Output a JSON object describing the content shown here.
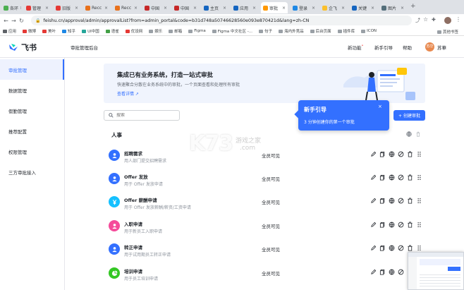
{
  "browser": {
    "tabs": [
      {
        "label": "各环",
        "color": "#4caf50",
        "active": false
      },
      {
        "label": "管理",
        "color": "#e53935",
        "active": false
      },
      {
        "label": "旧版",
        "color": "#e53935",
        "active": false
      },
      {
        "label": "Recc",
        "color": "#e8711c",
        "active": false
      },
      {
        "label": "Recc",
        "color": "#e8711c",
        "active": false
      },
      {
        "label": "中国",
        "color": "#c62828",
        "active": false
      },
      {
        "label": "中国",
        "color": "#c62828",
        "active": false
      },
      {
        "label": "主页",
        "color": "#1565c0",
        "active": false
      },
      {
        "label": "应用",
        "color": "#1565c0",
        "active": false
      },
      {
        "label": "审批",
        "color": "#ff9800",
        "active": true
      },
      {
        "label": "登录",
        "color": "#1e88e5",
        "active": false
      },
      {
        "label": "企飞",
        "color": "#fbc02d",
        "active": false
      },
      {
        "label": "关键",
        "color": "#1565c0",
        "active": false
      },
      {
        "label": "图片",
        "color": "#546e7a",
        "active": false
      }
    ],
    "url": "feishu.cn/approval/admin/approvalList?from=admin_portal&code=b31d748a50746628560e093e870421d&lang=zh-CN",
    "bookmarks": [
      {
        "label": "应用",
        "color": "#5f6368"
      },
      {
        "label": "微博",
        "color": "#e53935"
      },
      {
        "label": "美叶",
        "color": "#e53935"
      },
      {
        "label": "知乎",
        "color": "#1e88e5"
      },
      {
        "label": "UI中国",
        "color": "#26a69a"
      },
      {
        "label": "语雀",
        "color": "#43a047"
      },
      {
        "label": "优设网",
        "color": "#e53935"
      },
      {
        "label": "娱乐",
        "color": "#9aa0a6"
      },
      {
        "label": "邮箱",
        "color": "#9aa0a6"
      },
      {
        "label": "Figma",
        "color": "#9aa0a6"
      },
      {
        "label": "Figma 中文社区 -...",
        "color": "#9aa0a6"
      },
      {
        "label": "句子",
        "color": "#9aa0a6"
      },
      {
        "label": "海内外竞品",
        "color": "#9aa0a6"
      },
      {
        "label": "后台页面",
        "color": "#9aa0a6"
      },
      {
        "label": "插件库",
        "color": "#9aa0a6"
      },
      {
        "label": "ICON",
        "color": "#9aa0a6"
      }
    ],
    "other_bookmarks": "其他书签"
  },
  "header": {
    "logo_text": "飞书",
    "console_title": "审批管理后台",
    "new_features": "新功能",
    "guide": "新手引导",
    "help": "帮助",
    "avatar_text": "苏华",
    "user_name": "苏華"
  },
  "sidebar": {
    "items": [
      {
        "label": "审批管理",
        "active": true
      },
      {
        "label": "数据管理",
        "active": false
      },
      {
        "label": "假勤管理",
        "active": false
      },
      {
        "label": "推荐配置",
        "active": false
      },
      {
        "label": "权限管理",
        "active": false
      },
      {
        "label": "三方审批接入",
        "active": false
      }
    ]
  },
  "banner": {
    "title": "集成已有业务系统，打造一站式审批",
    "desc": "快速聚合分散在业务系统中的审批，一个页面查看和处理所有审批",
    "link": "查看详情 ↗"
  },
  "search": {
    "placeholder": "搜索"
  },
  "create_button": "+ 创建审批",
  "popover": {
    "title": "新手引导",
    "desc": "3 分钟创建你的第一个审批",
    "close": "×"
  },
  "section": {
    "title": "人事"
  },
  "watermark": {
    "big": "K73",
    "small_top": "游戏之家",
    "small_bottom": ".com"
  },
  "rows": [
    {
      "name": "招聘需求",
      "desc": "用人部门提交招聘需求",
      "visibility": "全员可见",
      "icon_color": "#3370ff",
      "icon": "person"
    },
    {
      "name": "Offer 发放",
      "desc": "用于 Offer 发放申请",
      "visibility": "全员可见",
      "icon_color": "#3370ff",
      "icon": "person"
    },
    {
      "name": "Offer 薪酬申请",
      "desc": "用于 Offer 发放薪酬/薪资/工资申请",
      "visibility": "全员可见",
      "icon_color": "#14c0ff",
      "icon": "yen"
    },
    {
      "name": "入职申请",
      "desc": "用于新员工入职申请",
      "visibility": "全员可见",
      "icon_color": "#f54a9a",
      "icon": "person"
    },
    {
      "name": "转正申请",
      "desc": "用于试用期员工转正申请",
      "visibility": "全员可见",
      "icon_color": "#3370ff",
      "icon": "person"
    },
    {
      "name": "培训申请",
      "desc": "用于员工培训申请",
      "visibility": "全员可见",
      "icon_color": "#34c724",
      "icon": "pie"
    }
  ]
}
